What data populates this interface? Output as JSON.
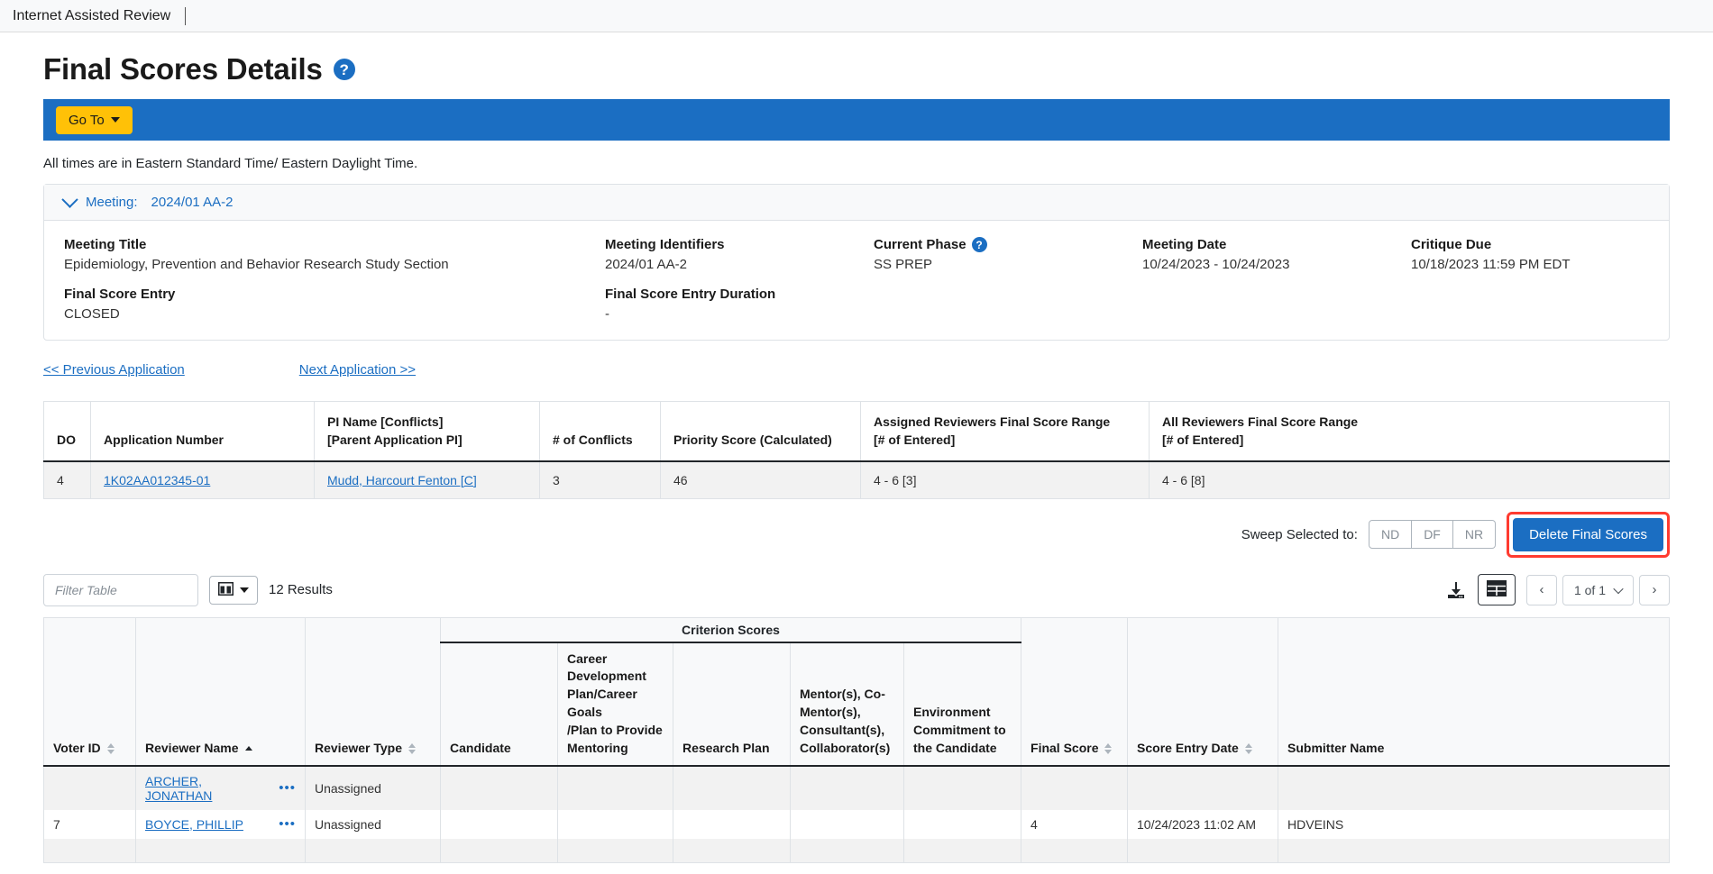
{
  "app": {
    "title": "Internet Assisted Review"
  },
  "header": {
    "page_title": "Final Scores Details",
    "help_icon": "question-mark-icon",
    "goto_button": "Go To",
    "time_note": "All times are in Eastern Standard Time/ Eastern Daylight Time."
  },
  "meeting_panel": {
    "toggle_label": "Meeting:",
    "toggle_value": "2024/01 AA-2",
    "fields": [
      {
        "label": "Meeting Title",
        "value": "Epidemiology, Prevention and Behavior Research Study Section"
      },
      {
        "label": "Meeting Identifiers",
        "value": "2024/01 AA-2"
      },
      {
        "label": "Current Phase",
        "value": "SS PREP",
        "has_help": true
      },
      {
        "label": "Meeting Date",
        "value": "10/24/2023 - 10/24/2023"
      },
      {
        "label": "Critique Due",
        "value": "10/18/2023 11:59 PM EDT"
      },
      {
        "label": "Final Score Entry",
        "value": "CLOSED"
      },
      {
        "label": "Final Score Entry Duration",
        "value": "-"
      }
    ]
  },
  "nav_links": {
    "previous": "<< Previous Application",
    "next": "Next Application >>"
  },
  "application_table": {
    "columns": [
      "DO",
      "Application Number",
      "PI Name [Conflicts]\n[Parent Application PI]",
      "# of Conflicts",
      "Priority Score (Calculated)",
      "Assigned Reviewers Final Score Range\n[# of Entered]",
      "All Reviewers Final Score Range\n[# of Entered]"
    ],
    "col_lines": [
      [
        "DO"
      ],
      [
        "Application Number"
      ],
      [
        "PI Name [Conflicts]",
        "[Parent Application PI]"
      ],
      [
        "# of Conflicts"
      ],
      [
        "Priority Score (Calculated)"
      ],
      [
        "Assigned Reviewers Final Score Range",
        "[# of Entered]"
      ],
      [
        "All Reviewers Final Score Range",
        "[# of Entered]"
      ]
    ],
    "row": {
      "do": "4",
      "application_number": "1K02AA012345-01",
      "pi_name": "Mudd, Harcourt Fenton [C]",
      "conflicts": "3",
      "priority_score": "46",
      "assigned_range": "4 -  6 [3]",
      "all_range": "4 -  6 [8]"
    }
  },
  "sweep": {
    "label": "Sweep Selected to:",
    "options": [
      "ND",
      "DF",
      "NR"
    ],
    "delete_button": "Delete Final Scores",
    "highlight_color": "#ff3b30"
  },
  "toolbar": {
    "filter_placeholder": "Filter Table",
    "filter_value": "",
    "column_chooser_icon": "columns-icon",
    "results_text": "12 Results",
    "download_icon": "download-icon",
    "grid_view_icon": "grid-icon",
    "prev_page_icon": "chevron-left-icon",
    "page_indicator": "1 of 1",
    "next_page_icon": "chevron-right-icon"
  },
  "scores_table": {
    "group_header": "Criterion Scores",
    "columns": [
      {
        "label": "Voter ID",
        "sortable": true,
        "sorted": "none"
      },
      {
        "label": "Reviewer Name",
        "sortable": true,
        "sorted": "asc"
      },
      {
        "label": "Reviewer Type",
        "sortable": true,
        "sorted": "none"
      },
      {
        "label": "Candidate",
        "sortable": false,
        "sorted": "none",
        "group": "Criterion Scores"
      },
      {
        "label": "Career Development Plan/Career Goals /Plan to Provide Mentoring",
        "sortable": false,
        "sorted": "none",
        "group": "Criterion Scores"
      },
      {
        "label": "Research Plan",
        "sortable": false,
        "sorted": "none",
        "group": "Criterion Scores"
      },
      {
        "label": "Mentor(s), Co-Mentor(s), Consultant(s), Collaborator(s)",
        "sortable": false,
        "sorted": "none",
        "group": "Criterion Scores"
      },
      {
        "label": "Environment Commitment to the Candidate",
        "sortable": false,
        "sorted": "none",
        "group": "Criterion Scores"
      },
      {
        "label": "Final Score",
        "sortable": true,
        "sorted": "none"
      },
      {
        "label": "Score Entry Date",
        "sortable": true,
        "sorted": "none"
      },
      {
        "label": "Submitter Name",
        "sortable": false,
        "sorted": "none"
      }
    ],
    "column_wrapped_lines": [
      [
        "Voter ID"
      ],
      [
        "Reviewer Name"
      ],
      [
        "Reviewer Type"
      ],
      [
        "Candidate"
      ],
      [
        "Career",
        "Development",
        "Plan/Career Goals",
        "/Plan to Provide",
        "Mentoring"
      ],
      [
        "Research Plan"
      ],
      [
        "Mentor(s), Co-",
        "Mentor(s),",
        "Consultant(s),",
        "Collaborator(s)"
      ],
      [
        "Environment",
        "Commitment to",
        "the Candidate"
      ],
      [
        "Final Score"
      ],
      [
        "Score Entry Date"
      ],
      [
        "Submitter Name"
      ]
    ],
    "row_menu_icon": "ellipsis-icon",
    "rows": [
      {
        "voter_id": "",
        "reviewer_name": "ARCHER, JONATHAN",
        "reviewer_type": "Unassigned",
        "candidate": "",
        "career_development": "",
        "research_plan": "",
        "mentors": "",
        "environment": "",
        "final_score": "",
        "score_entry_date": "",
        "submitter_name": ""
      },
      {
        "voter_id": "7",
        "reviewer_name": "BOYCE, PHILLIP",
        "reviewer_type": "Unassigned",
        "candidate": "",
        "career_development": "",
        "research_plan": "",
        "mentors": "",
        "environment": "",
        "final_score": "4",
        "score_entry_date": "10/24/2023 11:02 AM",
        "submitter_name": "HDVEINS"
      },
      {
        "voter_id": "",
        "reviewer_name": "",
        "reviewer_type": "",
        "candidate": "",
        "career_development": "",
        "research_plan": "",
        "mentors": "",
        "environment": "",
        "final_score": "",
        "score_entry_date": "",
        "submitter_name": ""
      }
    ]
  },
  "colors": {
    "brand_blue": "#1b6ec2",
    "accent_yellow": "#ffc107",
    "highlight_red": "#ff3b30",
    "link_blue": "#1b6ec2"
  }
}
